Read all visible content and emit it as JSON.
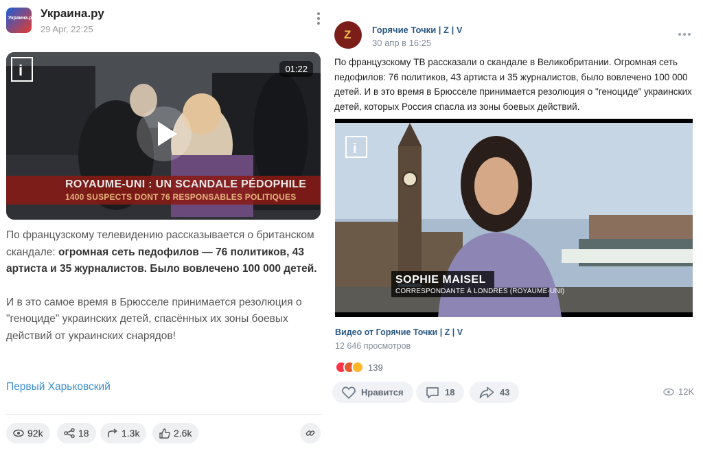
{
  "left_post": {
    "channel_name": "Украина.ру",
    "avatar_text": "Украина.ру",
    "date": "29 Apr, 22:25",
    "video": {
      "duration": "01:22",
      "caption_line1": "ROYAUME-UNI : UN SCANDALE PÉDOPHILE",
      "caption_line2": "1400 SUSPECTS DONT 76 RESPONSABLES POLITIQUES",
      "logo": "i"
    },
    "text": {
      "p1_plain": "По французскому телевидению рассказывается о британском скандале: ",
      "p1_bold": "огромная сеть педофилов — 76 политиков, 43 артиста и 35 журналистов. Было вовлечено 100 000 детей.",
      "p2": "И в это самое время в Брюсселе принимается резолюция о \"геноциде\" украинских детей, спасённых их зоны боевых действий от украинских снарядов!"
    },
    "link": "Первый Харьковский",
    "stats": {
      "views": "92k",
      "shares": "18",
      "forwards": "1.3k",
      "likes": "2.6k"
    }
  },
  "right_post": {
    "channel_name": "Горячие Точки | Z | V",
    "avatar_text": "Z",
    "date": "30 апр в 16:25",
    "text": "По французскому ТВ рассказали о скандале в Великобритании. Огромная сеть педофилов: 76 политиков, 43 артиста и 35 журналистов, было вовлечено 100 000 детей. И в это время в Брюсселе принимается резолюция о \"геноциде\" украинских детей, которых Россия спасла из зоны боевых действий.",
    "video": {
      "name_line1": "SOPHIE MAISEL",
      "name_line2": "CORRESPONDANTE À LONDRES (ROYAUME-UNI)",
      "logo": "i TELE"
    },
    "video_title": "Видео от Горячие Точки | Z | V",
    "video_views": "12 646 просмотров",
    "reaction_count": "139",
    "buttons": {
      "like": "Нравится",
      "comments": "18",
      "shares": "43"
    },
    "views": "12K"
  },
  "colors": {
    "vk_link": "#2a5885",
    "telegram_link": "#3a8fd0",
    "pill_bg": "#eef0f2"
  }
}
